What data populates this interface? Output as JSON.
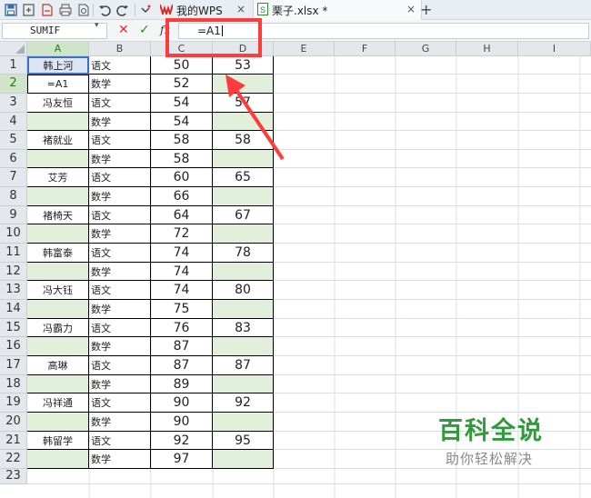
{
  "toolbar": {
    "icons": [
      "save-icon",
      "save-as-icon",
      "export-pdf-icon",
      "print-icon",
      "print-preview-icon",
      "undo-icon",
      "redo-icon",
      "customize-toolbar-icon"
    ]
  },
  "tabs": [
    {
      "label": "我的WPS",
      "icon": "wps-logo-icon",
      "close": "×"
    },
    {
      "label": "栗子.xlsx *",
      "icon": "spreadsheet-file-icon",
      "close": "×"
    }
  ],
  "new_tab_label": "+",
  "formula_bar": {
    "name_box": "SUMIF",
    "cancel_label": "✕",
    "confirm_label": "✓",
    "fx_label": "fx",
    "value": "=A1"
  },
  "columns": [
    "A",
    "B",
    "C",
    "D",
    "E",
    "F",
    "G",
    "H",
    "I"
  ],
  "rows": [
    "1",
    "2",
    "3",
    "4",
    "5",
    "6",
    "7",
    "8",
    "9",
    "10",
    "11",
    "12",
    "13",
    "14",
    "15",
    "16",
    "17",
    "18",
    "19",
    "20",
    "21",
    "22",
    "23"
  ],
  "cells": {
    "A": [
      "韩上河",
      "=A1",
      "冯友恒",
      "",
      "褚就业",
      "",
      "艾芳",
      "",
      "褚椅天",
      "",
      "韩富泰",
      "",
      "冯大钰",
      "",
      "冯霸力",
      "",
      "高琳",
      "",
      "冯祥通",
      "",
      "韩留学",
      "",
      ""
    ],
    "B": [
      "语文",
      "数学",
      "语文",
      "数学",
      "语文",
      "数学",
      "语文",
      "数学",
      "语文",
      "数学",
      "语文",
      "数学",
      "语文",
      "数学",
      "语文",
      "数学",
      "语文",
      "数学",
      "语文",
      "数学",
      "语文",
      "数学",
      ""
    ],
    "C": [
      "50",
      "52",
      "54",
      "54",
      "58",
      "58",
      "60",
      "66",
      "64",
      "72",
      "74",
      "74",
      "74",
      "75",
      "76",
      "87",
      "87",
      "89",
      "90",
      "90",
      "92",
      "97",
      ""
    ],
    "D": [
      "53",
      "",
      "57",
      "",
      "58",
      "",
      "65",
      "",
      "67",
      "",
      "78",
      "",
      "80",
      "",
      "83",
      "",
      "87",
      "",
      "92",
      "",
      "95",
      "",
      ""
    ]
  },
  "selection": {
    "active_cell": "A2",
    "editing_formula": "=A1"
  },
  "colors": {
    "highlight_green": "#e2efda",
    "active_blue": "#3b6fcc",
    "annotation_red": "#ff3b3b",
    "watermark_green": "#2f9b3b"
  },
  "watermark": {
    "title": "百科全说",
    "subtitle": "助你轻松解决"
  }
}
